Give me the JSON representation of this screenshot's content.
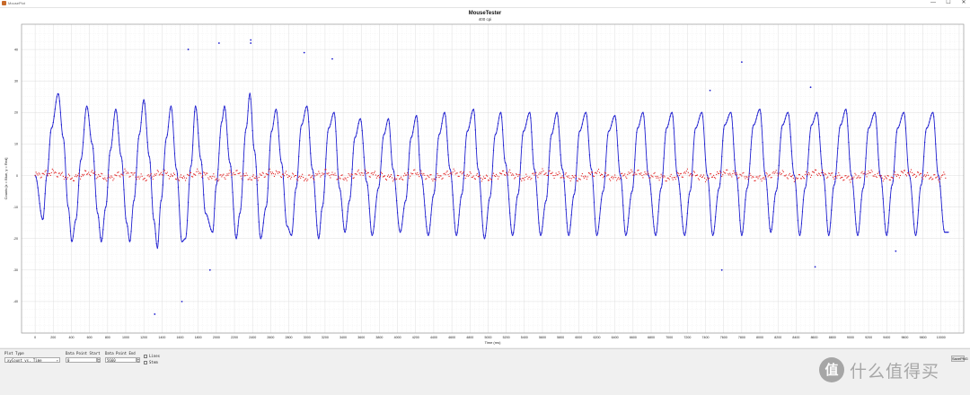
{
  "window": {
    "title": "MousePlot",
    "controls": [
      "—",
      "☐",
      "✕"
    ]
  },
  "chart_data": {
    "type": "scatter",
    "title": "MouseTester",
    "subtitle": "400 cpi",
    "xlabel": "Time (ms)",
    "ylabel": "Counts [x = Blue, y = Red]",
    "xlim": [
      -150,
      10250
    ],
    "ylim": [
      -50,
      48
    ],
    "xticks": [
      0,
      200,
      400,
      600,
      800,
      1000,
      1200,
      1400,
      1600,
      1800,
      2000,
      2200,
      2400,
      2600,
      2800,
      3000,
      3200,
      3400,
      3600,
      3800,
      4000,
      4200,
      4400,
      4600,
      4800,
      5000,
      5200,
      5400,
      5600,
      5800,
      6000,
      6200,
      6400,
      6600,
      6800,
      7000,
      7200,
      7400,
      7600,
      7800,
      8000,
      8200,
      8400,
      8600,
      8800,
      9000,
      9200,
      9400,
      9600,
      9800,
      10000
    ],
    "yticks": [
      -40,
      -30,
      -20,
      -10,
      0,
      10,
      20,
      30,
      40
    ],
    "grid": true,
    "series": [
      {
        "name": "x",
        "color": "#2020d0",
        "style": "line-with-markers",
        "points": [
          [
            0,
            0
          ],
          [
            85,
            -14
          ],
          [
            130,
            0
          ],
          [
            180,
            15
          ],
          [
            255,
            26
          ],
          [
            310,
            12
          ],
          [
            365,
            -10
          ],
          [
            405,
            -21
          ],
          [
            450,
            -14
          ],
          [
            505,
            5
          ],
          [
            570,
            22
          ],
          [
            630,
            10
          ],
          [
            690,
            -12
          ],
          [
            730,
            -21
          ],
          [
            780,
            -10
          ],
          [
            830,
            8
          ],
          [
            890,
            21
          ],
          [
            950,
            6
          ],
          [
            1010,
            -15
          ],
          [
            1045,
            -21
          ],
          [
            1090,
            -8
          ],
          [
            1150,
            13
          ],
          [
            1200,
            24
          ],
          [
            1260,
            6
          ],
          [
            1310,
            -14
          ],
          [
            1350,
            -23
          ],
          [
            1390,
            -8
          ],
          [
            1450,
            12
          ],
          [
            1500,
            22
          ],
          [
            1560,
            2
          ],
          [
            1620,
            -21
          ],
          [
            1660,
            -20
          ],
          [
            1720,
            3
          ],
          [
            1770,
            22
          ],
          [
            1830,
            5
          ],
          [
            1880,
            -12
          ],
          [
            1960,
            -18
          ],
          [
            2000,
            -3
          ],
          [
            2060,
            17
          ],
          [
            2090,
            22
          ],
          [
            2150,
            4
          ],
          [
            2220,
            -20
          ],
          [
            2260,
            -12
          ],
          [
            2330,
            15
          ],
          [
            2370,
            26
          ],
          [
            2420,
            8
          ],
          [
            2490,
            -20
          ],
          [
            2550,
            -10
          ],
          [
            2610,
            14
          ],
          [
            2660,
            21
          ],
          [
            2720,
            4
          ],
          [
            2780,
            -16
          ],
          [
            2830,
            -19
          ],
          [
            2880,
            -4
          ],
          [
            2940,
            16
          ],
          [
            3000,
            22
          ],
          [
            3060,
            2
          ],
          [
            3130,
            -20
          ],
          [
            3170,
            -10
          ],
          [
            3240,
            15
          ],
          [
            3300,
            20
          ],
          [
            3360,
            -4
          ],
          [
            3420,
            -18
          ],
          [
            3470,
            -8
          ],
          [
            3530,
            12
          ],
          [
            3590,
            18
          ],
          [
            3660,
            -2
          ],
          [
            3720,
            -19
          ],
          [
            3790,
            -4
          ],
          [
            3850,
            13
          ],
          [
            3900,
            18
          ],
          [
            3950,
            2
          ],
          [
            4030,
            -18
          ],
          [
            4090,
            -8
          ],
          [
            4150,
            12
          ],
          [
            4210,
            19
          ],
          [
            4260,
            0
          ],
          [
            4340,
            -19
          ],
          [
            4400,
            -6
          ],
          [
            4460,
            13
          ],
          [
            4520,
            20
          ],
          [
            4580,
            2
          ],
          [
            4650,
            -19
          ],
          [
            4710,
            -6
          ],
          [
            4770,
            14
          ],
          [
            4840,
            21
          ],
          [
            4890,
            2
          ],
          [
            4960,
            -20
          ],
          [
            5020,
            -7
          ],
          [
            5080,
            13
          ],
          [
            5140,
            20
          ],
          [
            5190,
            4
          ],
          [
            5270,
            -19
          ],
          [
            5330,
            -6
          ],
          [
            5390,
            14
          ],
          [
            5460,
            20
          ],
          [
            5510,
            2
          ],
          [
            5580,
            -19
          ],
          [
            5640,
            -8
          ],
          [
            5700,
            13
          ],
          [
            5760,
            20
          ],
          [
            5820,
            2
          ],
          [
            5890,
            -19
          ],
          [
            5950,
            -6
          ],
          [
            6010,
            14
          ],
          [
            6080,
            20
          ],
          [
            6140,
            2
          ],
          [
            6200,
            -19
          ],
          [
            6270,
            -5
          ],
          [
            6330,
            14
          ],
          [
            6400,
            19
          ],
          [
            6460,
            0
          ],
          [
            6520,
            -19
          ],
          [
            6590,
            -5
          ],
          [
            6650,
            15
          ],
          [
            6710,
            20
          ],
          [
            6770,
            0
          ],
          [
            6850,
            -19
          ],
          [
            6910,
            -4
          ],
          [
            6970,
            15
          ],
          [
            7030,
            20
          ],
          [
            7090,
            0
          ],
          [
            7170,
            -19
          ],
          [
            7230,
            -5
          ],
          [
            7290,
            15
          ],
          [
            7360,
            20
          ],
          [
            7420,
            0
          ],
          [
            7480,
            -19
          ],
          [
            7550,
            -4
          ],
          [
            7610,
            16
          ],
          [
            7680,
            20
          ],
          [
            7740,
            0
          ],
          [
            7800,
            -19
          ],
          [
            7860,
            -4
          ],
          [
            7930,
            16
          ],
          [
            8000,
            21
          ],
          [
            8060,
            0
          ],
          [
            8120,
            -18
          ],
          [
            8180,
            -5
          ],
          [
            8250,
            16
          ],
          [
            8310,
            20
          ],
          [
            8380,
            0
          ],
          [
            8440,
            -19
          ],
          [
            8500,
            -4
          ],
          [
            8570,
            16
          ],
          [
            8630,
            20
          ],
          [
            8700,
            0
          ],
          [
            8760,
            -19
          ],
          [
            8820,
            -3
          ],
          [
            8890,
            16
          ],
          [
            8950,
            21
          ],
          [
            9010,
            0
          ],
          [
            9080,
            -19
          ],
          [
            9140,
            -4
          ],
          [
            9200,
            15
          ],
          [
            9270,
            20
          ],
          [
            9330,
            0
          ],
          [
            9400,
            -19
          ],
          [
            9460,
            -3
          ],
          [
            9520,
            15
          ],
          [
            9590,
            20
          ],
          [
            9650,
            0
          ],
          [
            9720,
            -19
          ],
          [
            9780,
            -3
          ],
          [
            9840,
            15
          ],
          [
            9910,
            20
          ],
          [
            9970,
            0
          ],
          [
            10040,
            -18
          ],
          [
            10080,
            -18
          ]
        ]
      },
      {
        "name": "y",
        "color": "#e01818",
        "style": "markers",
        "points": [
          [
            0,
            0
          ],
          [
            200,
            1
          ],
          [
            400,
            -1
          ],
          [
            600,
            1
          ],
          [
            800,
            -1
          ],
          [
            1000,
            1
          ],
          [
            1200,
            -1
          ],
          [
            1400,
            1
          ],
          [
            1600,
            -1
          ],
          [
            1800,
            1
          ],
          [
            2000,
            -1
          ],
          [
            2200,
            1
          ],
          [
            2400,
            -1
          ],
          [
            2600,
            1
          ],
          [
            2800,
            0
          ],
          [
            3000,
            -1
          ],
          [
            3200,
            1
          ],
          [
            3400,
            -1
          ],
          [
            3600,
            1
          ],
          [
            3800,
            0
          ],
          [
            4000,
            -1
          ],
          [
            4200,
            1
          ],
          [
            4400,
            -1
          ],
          [
            4600,
            1
          ],
          [
            4800,
            0
          ],
          [
            5000,
            -1
          ],
          [
            5200,
            1
          ],
          [
            5400,
            -1
          ],
          [
            5600,
            1
          ],
          [
            5800,
            0
          ],
          [
            6000,
            -1
          ],
          [
            6200,
            1
          ],
          [
            6400,
            -1
          ],
          [
            6600,
            1
          ],
          [
            6800,
            0
          ],
          [
            7000,
            -1
          ],
          [
            7200,
            1
          ],
          [
            7400,
            -1
          ],
          [
            7600,
            1
          ],
          [
            7800,
            0
          ],
          [
            8000,
            -1
          ],
          [
            8200,
            1
          ],
          [
            8400,
            -1
          ],
          [
            8600,
            1
          ],
          [
            8800,
            0
          ],
          [
            9000,
            -1
          ],
          [
            9200,
            1
          ],
          [
            9400,
            -1
          ],
          [
            9600,
            1
          ],
          [
            9800,
            0
          ],
          [
            10000,
            -1
          ]
        ]
      }
    ],
    "outliers": [
      [
        1690,
        40
      ],
      [
        2030,
        42
      ],
      [
        2380,
        43
      ],
      [
        2380,
        42
      ],
      [
        2970,
        39
      ],
      [
        3280,
        37
      ],
      [
        7800,
        36
      ],
      [
        7450,
        27
      ],
      [
        8560,
        28
      ],
      [
        1320,
        -44
      ],
      [
        1620,
        -40
      ],
      [
        1930,
        -30
      ],
      [
        7580,
        -30
      ],
      [
        8610,
        -29
      ],
      [
        9500,
        -24
      ]
    ]
  },
  "controls": {
    "plot_type_label": "Plot Type",
    "plot_type_value": "xyCount vs. Time",
    "start_label": "Data Point Start",
    "start_value": "0",
    "end_label": "Data Point End",
    "end_value": "5660",
    "lines_label": "Lines",
    "stem_label": "Stem",
    "save_label": "SavePNG"
  },
  "watermark": {
    "glyph": "值",
    "text": "什么值得买"
  }
}
